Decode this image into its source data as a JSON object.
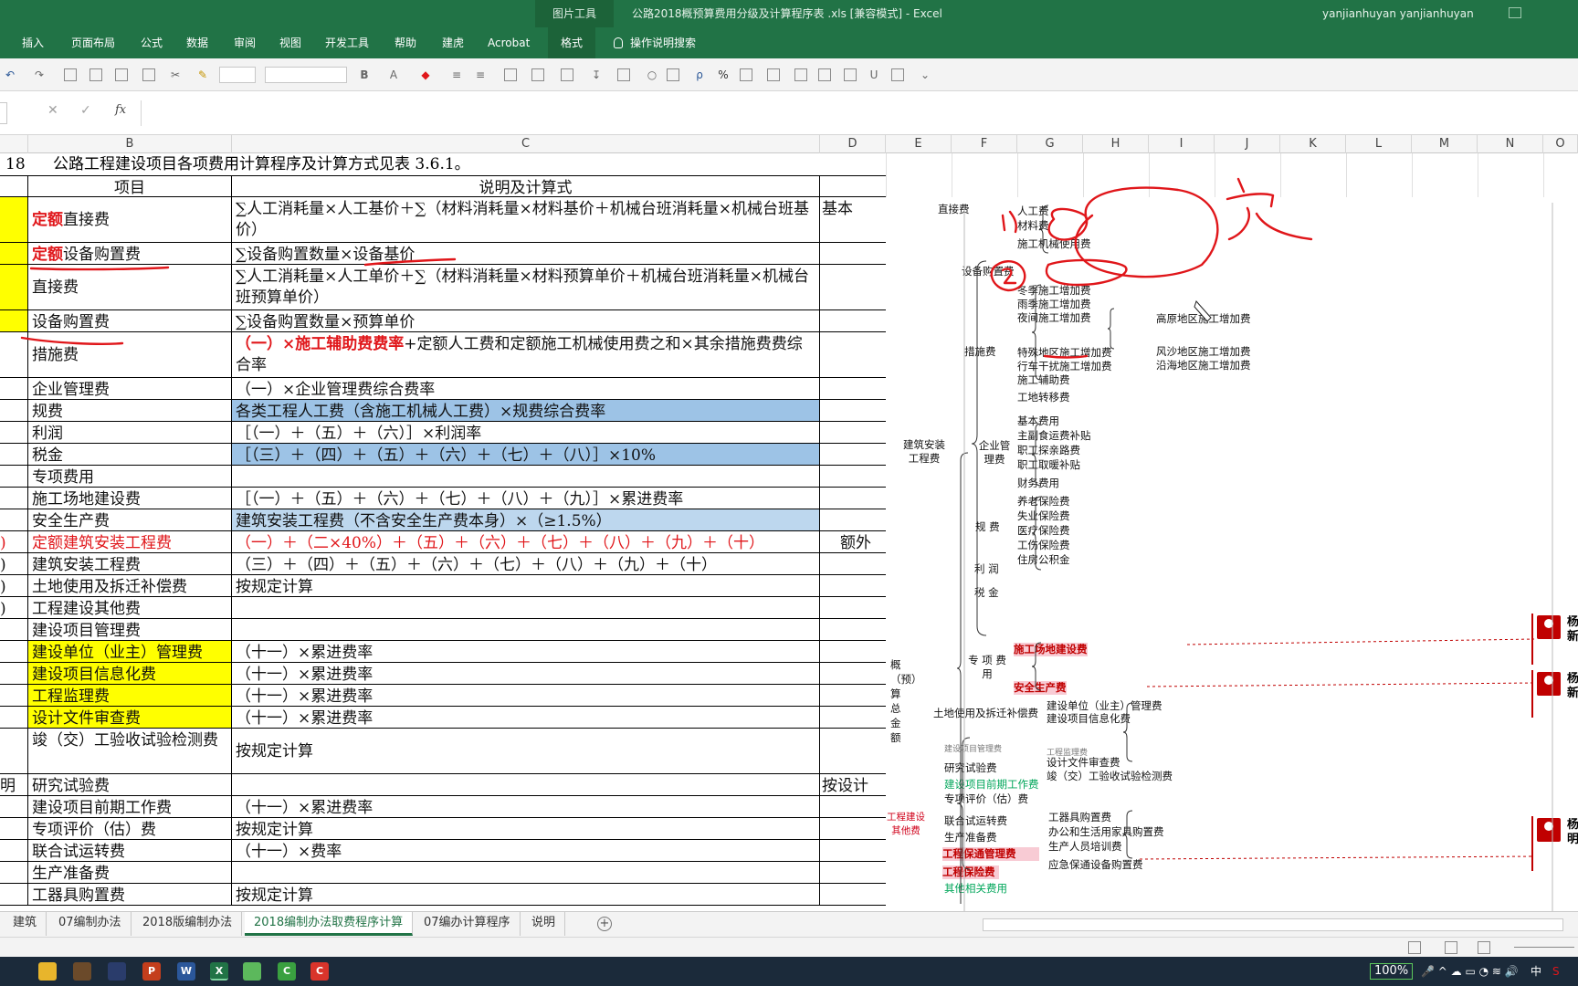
{
  "titlebar": {
    "context_tab": "图片工具",
    "title": "公路2018概预算费用分级及计算程序表 .xls  [兼容模式]  -  Excel",
    "user": "yanjianhuyan yanjianhuyan"
  },
  "ribbon": {
    "tabs": [
      "插入",
      "页面布局",
      "公式",
      "数据",
      "审阅",
      "视图",
      "开发工具",
      "帮助",
      "建虎",
      "Acrobat",
      "格式"
    ],
    "tell_me": "操作说明搜索"
  },
  "toolbar": {
    "font_name": "",
    "font_size": "",
    "bold": "B",
    "font_color": "A",
    "percent": "%",
    "search": "ρ"
  },
  "formula_bar": {
    "cancel": "✕",
    "enter": "✓",
    "fx": "fx",
    "value": ""
  },
  "columns": [
    "B",
    "C",
    "D",
    "E",
    "F",
    "G",
    "H",
    "I",
    "J",
    "K",
    "L",
    "M",
    "N",
    "O"
  ],
  "sheet": {
    "title_row_num": "18",
    "title": "公路工程建设项目各项费用计算程序及计算方式见表 3.6.1。",
    "header_item": "项目",
    "header_desc": "说明及计算式",
    "rows": [
      {
        "a": "",
        "item_red": "定额",
        "item": "直接费",
        "desc": "∑人工消耗量×人工基价＋∑（材料消耗量×材料基价＋机械台班消耗量×机械台班基价）",
        "d": "基本"
      },
      {
        "a": "",
        "item_red": "定额",
        "item": "设备购置费",
        "desc": "∑设备购置数量×设备基价",
        "d": ""
      },
      {
        "a": "",
        "item_red": "",
        "item": "直接费",
        "desc": "∑人工消耗量×人工单价＋∑（材料消耗量×材料预算单价＋机械台班消耗量×机械台班预算单价）",
        "d": ""
      },
      {
        "a": "",
        "item_red": "",
        "item": "设备购置费",
        "desc": "∑设备购置数量×预算单价",
        "d": ""
      },
      {
        "a": "",
        "item_red": "",
        "item": "措施费",
        "desc_red": "（一）×施工辅助费费率",
        "desc": "+定额人工费和定额施工机械使用费之和×其余措施费费综合率",
        "d": ""
      },
      {
        "a": "",
        "item_red": "",
        "item": "企业管理费",
        "desc": "（一）×企业管理费综合费率",
        "d": ""
      },
      {
        "a": "",
        "item_red": "",
        "item": "规费",
        "desc": "各类工程人工费（含施工机械人工费）×规费综合费率",
        "d": ""
      },
      {
        "a": "",
        "item_red": "",
        "item": "利润",
        "desc": "［（一）＋（五）＋（六）］×利润率",
        "d": ""
      },
      {
        "a": "",
        "item_red": "",
        "item": "税金",
        "desc": "［（三）＋（四）＋（五）＋（六）＋（七）＋（八）］×10%",
        "d": ""
      },
      {
        "a": "",
        "item_red": "",
        "item": "专项费用",
        "desc": "",
        "d": ""
      },
      {
        "a": "",
        "item_red": "",
        "item": "施工场地建设费",
        "desc": "［（一）＋（五）＋（六）＋（七）＋（八）＋（九）］×累进费率",
        "d": ""
      },
      {
        "a": "",
        "item_red": "",
        "item": "安全生产费",
        "desc": "建筑安装工程费（不含安全生产费本身）×（≥1.5%）",
        "d": ""
      },
      {
        "a": ")",
        "item_red": "",
        "item": "定额建筑安装工程费",
        "desc": "（一）＋（二×40%）＋（五）＋（六）＋（七）＋（八）＋（九）＋（十）",
        "d": "额外增"
      },
      {
        "a": ")",
        "item_red": "",
        "item": "建筑安装工程费",
        "desc": "（三）＋（四）＋（五）＋（六）＋（七）＋（八）＋（九）＋（十）",
        "d": ""
      },
      {
        "a": ")",
        "item_red": "",
        "item": "土地使用及拆迁补偿费",
        "desc": "按规定计算",
        "d": ""
      },
      {
        "a": ")",
        "item_red": "",
        "item": "工程建设其他费",
        "desc": "",
        "d": ""
      },
      {
        "a": "",
        "item_red": "",
        "item": "建设项目管理费",
        "desc": "",
        "d": ""
      },
      {
        "a": "",
        "item_red": "",
        "item": "建设单位（业主）管理费",
        "desc": "（十一）×累进费率",
        "d": ""
      },
      {
        "a": "",
        "item_red": "",
        "item": "建设项目信息化费",
        "desc": "（十一）×累进费率",
        "d": ""
      },
      {
        "a": "",
        "item_red": "",
        "item": "工程监理费",
        "desc": "（十一）×累进费率",
        "d": ""
      },
      {
        "a": "",
        "item_red": "",
        "item": "设计文件审查费",
        "desc": "（十一）×累进费率",
        "d": ""
      },
      {
        "a": "",
        "item_red": "",
        "item": "竣（交）工验收试验检测费",
        "desc": "按规定计算",
        "d": ""
      },
      {
        "a": "明",
        "item_red": "",
        "item": "研究试验费",
        "desc": "",
        "d": "按设计提出"
      },
      {
        "a": "",
        "item_red": "",
        "item": "建设项目前期工作费",
        "desc": "（十一）×累进费率",
        "d": ""
      },
      {
        "a": "",
        "item_red": "",
        "item": "专项评价（估）费",
        "desc": "按规定计算",
        "d": ""
      },
      {
        "a": "",
        "item_red": "",
        "item": "联合试运转费",
        "desc": "（十一）×费率",
        "d": ""
      },
      {
        "a": "",
        "item_red": "",
        "item": "生产准备费",
        "desc": "",
        "d": ""
      },
      {
        "a": "",
        "item_red": "",
        "item": "工器具购置费",
        "desc": "按规定计算",
        "d": ""
      }
    ]
  },
  "diagram": {
    "root": "概（预）算总金额",
    "jianan": "建筑安装工程费",
    "zhijie": "直接费",
    "zhijie_items": [
      "人工费",
      "材料费",
      "施工机械使用费"
    ],
    "shebei": "设备购置费",
    "cuoshi": "措施费",
    "cuoshi_items": [
      "冬季施工增加费",
      "雨季施工增加费",
      "夜间施工增加费",
      "特殊地区施工增加费",
      "行车干扰施工增加费",
      "施工辅助费",
      "工地转移费"
    ],
    "teshu_items": [
      "高原地区施工增加费",
      "风沙地区施工增加费",
      "沿海地区施工增加费"
    ],
    "qiye": "企业管理费",
    "qiye_items": [
      "基本费用",
      "主副食运费补贴",
      "职工探亲路费",
      "职工取暖补贴",
      "财务费用"
    ],
    "guifei": "规 费",
    "guifei_items": [
      "养老保险费",
      "失业保险费",
      "医疗保险费",
      "工伤保险费",
      "住房公积金"
    ],
    "lirun": "利 润",
    "shuijin": "税 金",
    "zhuanxiang": "专 项 费 用",
    "zhuanxiang_items": [
      "施工场地建设费",
      "安全生产费"
    ],
    "tudi": "土地使用及拆迁补偿费",
    "qita": "工程建设其他费",
    "qita_items": [
      "建设项目管理费",
      "研究试验费",
      "建设项目前期工作费",
      "专项评价（估）费",
      "联合试运转费",
      "生产准备费",
      "工程保通管理费",
      "工程保险费",
      "其他相关费用"
    ],
    "guanli_items": [
      "建设单位（业主）管理费",
      "建设项目信息化费",
      "工程监理费",
      "设计文件审查费",
      "竣（交）工验收试验检测费"
    ],
    "shengchan_items": [
      "工器具购置费",
      "办公和生活用家具购置费",
      "生产人员培训费",
      "应急保通设备购置费"
    ],
    "comment_names": [
      "杨新",
      "杨新",
      "杨明"
    ]
  },
  "sheet_tabs": [
    "建筑",
    "07编制办法",
    "2018版编制办法",
    "2018编制办法取费程序计算",
    "07编办计算程序",
    "说明"
  ],
  "active_sheet": "2018编制办法取费程序计算",
  "taskbar": {
    "zoom": "100%",
    "ime": "中",
    "apps": [
      "P",
      "W",
      "X",
      "C",
      "C"
    ]
  },
  "colors": {
    "excel_green": "#217346",
    "highlight_yellow": "#ffff00",
    "highlight_blue": "#9dc3e6",
    "annotation_red": "#e0161a"
  }
}
